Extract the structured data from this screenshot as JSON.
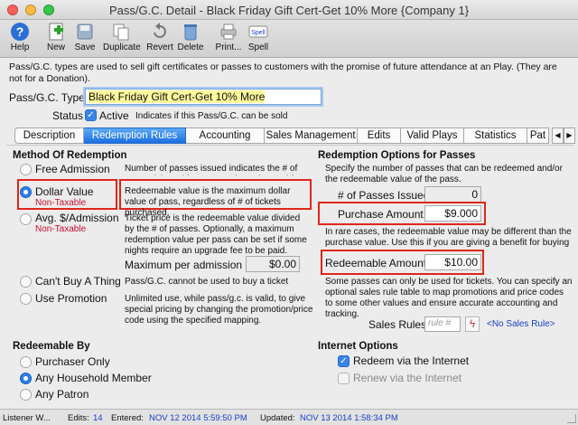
{
  "window": {
    "title": "Pass/G.C. Detail - Black Friday Gift Cert-Get 10% More {Company 1}"
  },
  "toolbar": {
    "help": "Help",
    "new": "New",
    "save": "Save",
    "duplicate": "Duplicate",
    "revert": "Revert",
    "delete": "Delete",
    "print": "Print...",
    "spell": "Spell",
    "spell_icon_text": "Spell"
  },
  "description": "Pass/G.C. types are used to sell gift certificates or passes to customers with the promise of future attendance at an Play.  (They are not for a Donation).",
  "type_field": {
    "label": "Pass/G.C. Type",
    "value": "Black Friday Gift Cert-Get 10% More"
  },
  "status": {
    "label": "Status",
    "active_label": "Active",
    "hint": "Indicates if this Pass/G.C. can be sold"
  },
  "tabs": [
    "Description",
    "Redemption Rules",
    "Accounting",
    "Sales Management",
    "Edits",
    "Valid Plays",
    "Statistics",
    "Pat"
  ],
  "method": {
    "heading": "Method Of Redemption",
    "free_label": "Free Admission",
    "free_desc": "Number of passes issued indicates the # of comp. tickets this pass can be redeemed for.",
    "dollar_label": "Dollar Value",
    "dollar_tax": "Non-Taxable",
    "dollar_desc": "Redeemable value is the maximum dollar value of pass, regardless of # of tickets purchased.",
    "avg_label": "Avg. $/Admission",
    "avg_tax": "Non-Taxable",
    "avg_desc": "Ticket price is the redeemable value divided by the # of passes.  Optionally, a maximum redemption value per pass can be set if some nights require an upgrade fee to be paid.",
    "max_label": "Maximum per admission",
    "max_value": "$0.00",
    "cant_label": "Can't Buy A Thing",
    "cant_desc": "Pass/G.C. cannot be used to buy a ticket",
    "promo_label": "Use Promotion",
    "promo_desc": "Unlimited use, while pass/g.c. is valid, to give special pricing by changing the promotion/price code using the specified mapping."
  },
  "redemption": {
    "heading": "Redemption Options for Passes",
    "intro": "Specify the number of passes that can be redeemed and/or the redeemable value of the pass.",
    "num_label": "# of Passes Issued",
    "num_value": "0",
    "purchase_label": "Purchase Amount",
    "purchase_value": "$9.000",
    "note": "In rare cases, the redeemable value may be different than the purchase value.  Use this if you are giving a benefit for buying early, or adding cost for processing the item.",
    "redeemable_label": "Redeemable Amount",
    "redeemable_value": "$10.00",
    "note2": "Some passes can only be used for tickets.  You can specify an optional sales rule table to map promotions and price codes to some other values and ensure accurate accounting and tracking.",
    "rules_label": "Sales Rules",
    "rules_placeholder": "rule #",
    "rules_link": "<No Sales Rule>"
  },
  "redeemable_by": {
    "heading": "Redeemable By",
    "purchaser": "Purchaser Only",
    "household": "Any Household Member",
    "patron": "Any Patron"
  },
  "internet": {
    "heading": "Internet Options",
    "redeem": "Redeem via the Internet",
    "renew": "Renew via the Internet"
  },
  "statusbar": {
    "user": "Listener W...",
    "edits_label": "Edits:",
    "edits_value": "14",
    "entered_label": "Entered:",
    "entered_value": "NOV 12 2014 5:59:50 PM",
    "updated_label": "Updated:",
    "updated_value": "NOV 13 2014 1:58:34 PM"
  },
  "colors": {
    "highlight_red": "#e0261b",
    "tab_selected": "#1b6fe0",
    "non_taxable": "#c8102e",
    "link_blue": "#1a3fc8"
  }
}
